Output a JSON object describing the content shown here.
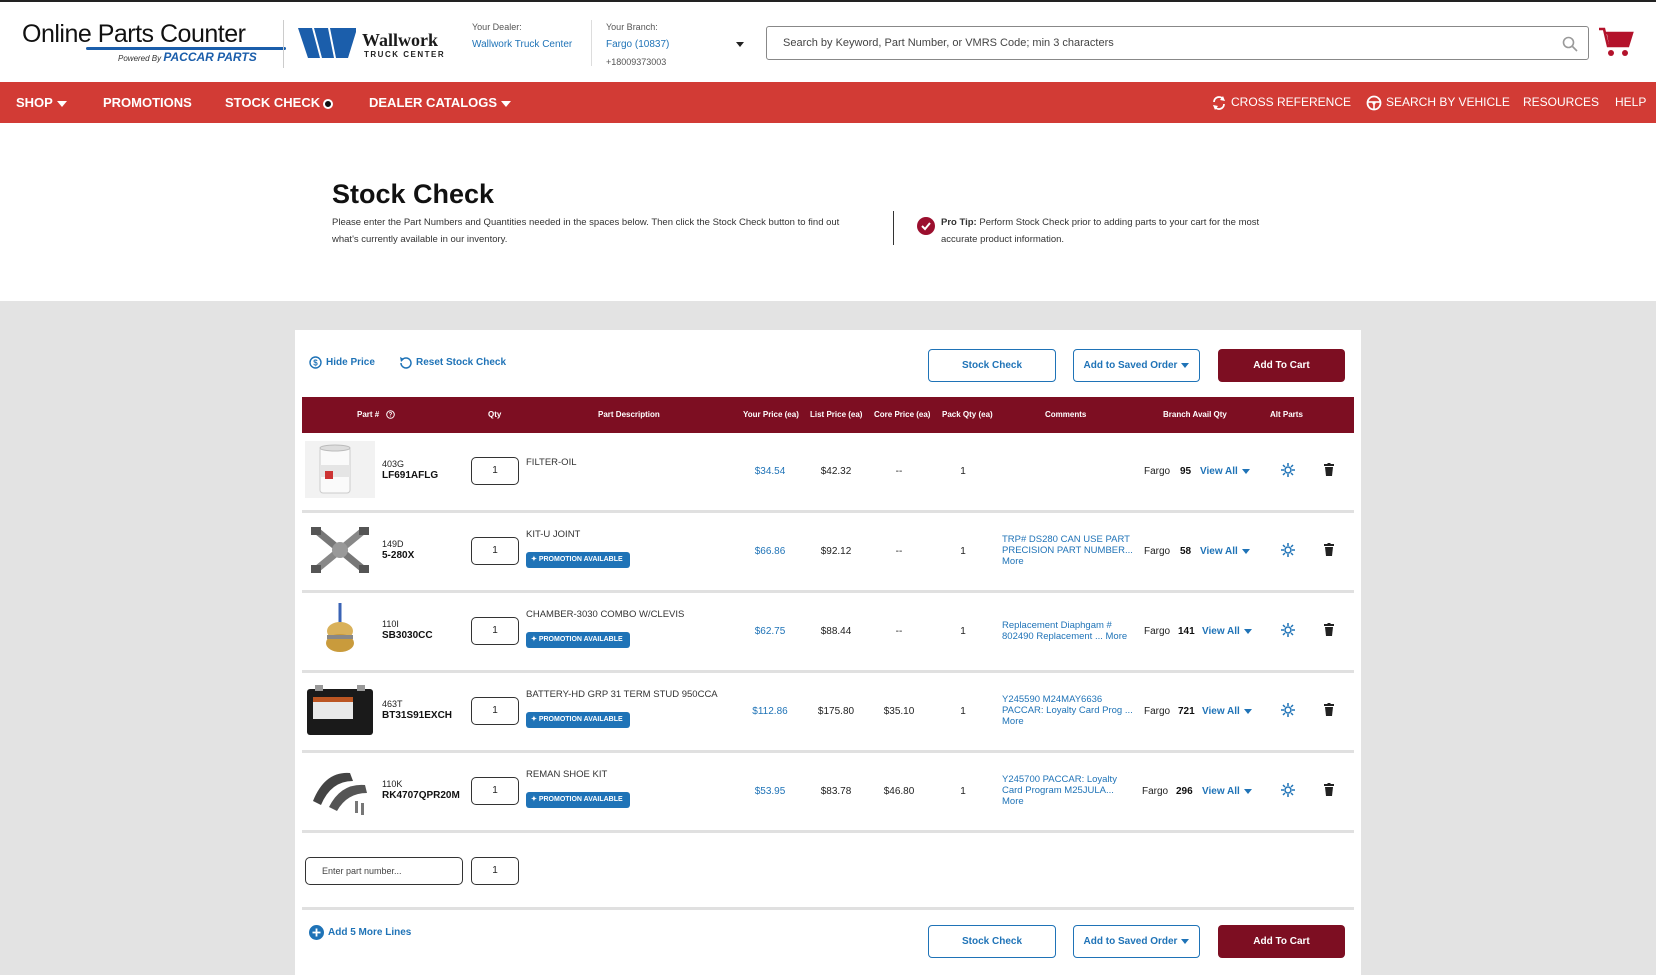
{
  "header": {
    "logo_main": "Online Parts Counter",
    "logo_powered": "Powered By",
    "logo_brand": "PACCAR PARTS",
    "dealer_logo_name": "Wallwork",
    "dealer_logo_sub": "TRUCK CENTER",
    "dealer_label": "Your Dealer:",
    "dealer_value": "Wallwork Truck Center",
    "branch_label": "Your Branch:",
    "branch_value": "Fargo (10837)",
    "branch_phone": "+18009373003",
    "search_placeholder": "Search by Keyword, Part Number, or VMRS Code; min 3 characters"
  },
  "nav": {
    "shop": "SHOP",
    "promotions": "PROMOTIONS",
    "stock_check": "STOCK CHECK",
    "dealer_catalogs": "DEALER CATALOGS",
    "cross_reference": "CROSS REFERENCE",
    "search_by_vehicle": "SEARCH BY VEHICLE",
    "resources": "RESOURCES",
    "help": "HELP"
  },
  "hero": {
    "title": "Stock Check",
    "description": "Please enter the Part Numbers and Quantities needed in the spaces below. Then click the Stock Check button to find out what's currently available in our inventory.",
    "tip_label": "Pro Tip:",
    "tip_text": "Perform Stock Check prior to adding parts to your cart for the most accurate product information."
  },
  "toolbar": {
    "hide_price": "Hide Price",
    "reset": "Reset Stock Check",
    "stock_check": "Stock Check",
    "add_to_saved": "Add to Saved Order",
    "add_to_cart": "Add To Cart",
    "add_more_lines": "Add 5 More Lines"
  },
  "table": {
    "headers": {
      "part": "Part #",
      "qty": "Qty",
      "desc": "Part Description",
      "your_price": "Your Price (ea)",
      "list_price": "List Price (ea)",
      "core_price": "Core Price (ea)",
      "pack_qty": "Pack Qty (ea)",
      "comments": "Comments",
      "branch_avail": "Branch Avail Qty",
      "alt_parts": "Alt Parts"
    },
    "promo_label": "PROMOTION AVAILABLE",
    "view_all": "View All",
    "rows": [
      {
        "line": "403G",
        "part": "LF691AFLG",
        "qty": "1",
        "desc": "FILTER-OIL",
        "promo": false,
        "your_price": "$34.54",
        "list_price": "$42.32",
        "core_price": "--",
        "pack_qty": "1",
        "comment": "",
        "branch": "Fargo",
        "avail": "95"
      },
      {
        "line": "149D",
        "part": "5-280X",
        "qty": "1",
        "desc": "KIT-U JOINT",
        "promo": true,
        "your_price": "$66.86",
        "list_price": "$92.12",
        "core_price": "--",
        "pack_qty": "1",
        "comment": "TRP# DS280 CAN USE PART PRECISION PART NUMBER... More",
        "branch": "Fargo",
        "avail": "58"
      },
      {
        "line": "110I",
        "part": "SB3030CC",
        "qty": "1",
        "desc": "CHAMBER-3030 COMBO W/CLEVIS",
        "promo": true,
        "your_price": "$62.75",
        "list_price": "$88.44",
        "core_price": "--",
        "pack_qty": "1",
        "comment": "Replacement Diaphgam # 802490 Replacement ... More",
        "branch": "Fargo",
        "avail": "141"
      },
      {
        "line": "463T",
        "part": "BT31S91EXCH",
        "qty": "1",
        "desc": "BATTERY-HD GRP 31 TERM STUD 950CCA",
        "promo": true,
        "your_price": "$112.86",
        "list_price": "$175.80",
        "core_price": "$35.10",
        "pack_qty": "1",
        "comment": "Y245590 M24MAY6636 PACCAR: Loyalty Card Prog ... More",
        "branch": "Fargo",
        "avail": "721"
      },
      {
        "line": "110K",
        "part": "RK4707QPR20M",
        "qty": "1",
        "desc": "REMAN SHOE KIT",
        "promo": true,
        "your_price": "$53.95",
        "list_price": "$83.78",
        "core_price": "$46.80",
        "pack_qty": "1",
        "comment": "Y245700 PACCAR: Loyalty Card Program M25JULA... More",
        "branch": "Fargo",
        "avail": "296"
      }
    ]
  },
  "new_line": {
    "placeholder": "Enter part number...",
    "qty": "1"
  },
  "colors": {
    "nav_red": "#d23b35",
    "maroon": "#7d0e22",
    "link_blue": "#1f73b7"
  }
}
